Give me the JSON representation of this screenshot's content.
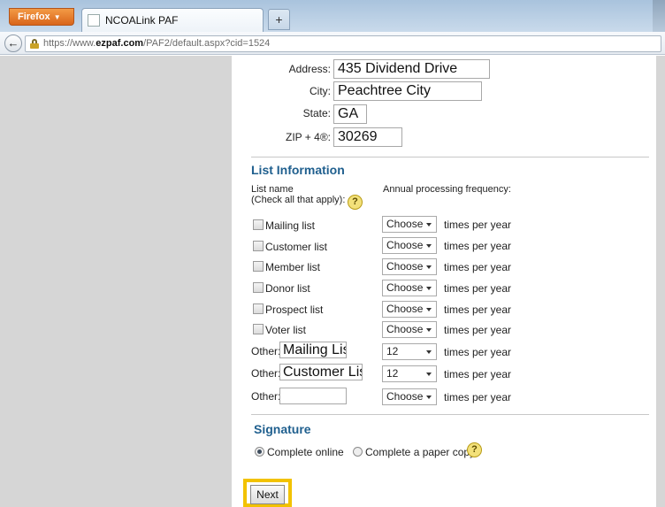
{
  "browser": {
    "firefox_label": "Firefox",
    "tab_title": "NCOALink PAF",
    "new_tab_label": "+",
    "url": {
      "prefix": "https://www.",
      "domain": "ezpaf.com",
      "path": "/PAF2/default.aspx?cid=1524"
    }
  },
  "address": {
    "address_label": "Address:",
    "address_value": "435 Dividend Drive",
    "city_label": "City:",
    "city_value": "Peachtree City",
    "state_label": "State:",
    "state_value": "GA",
    "zip_label": "ZIP + 4®:",
    "zip_value": "30269"
  },
  "list_info": {
    "title": "List Information",
    "list_name_header_1": "List name",
    "list_name_header_2": "(Check all that apply):",
    "frequency_header": "Annual processing frequency:",
    "times_per_year": "times per year",
    "lists": [
      {
        "label": "Mailing list",
        "frequency": "Choose",
        "checked": false
      },
      {
        "label": "Customer list",
        "frequency": "Choose",
        "checked": false
      },
      {
        "label": "Member list",
        "frequency": "Choose",
        "checked": false
      },
      {
        "label": "Donor list",
        "frequency": "Choose",
        "checked": false
      },
      {
        "label": "Prospect list",
        "frequency": "Choose",
        "checked": false
      },
      {
        "label": "Voter list",
        "frequency": "Choose",
        "checked": false
      }
    ],
    "other_label": "Other:",
    "others": [
      {
        "value": "Mailing List",
        "frequency": "12"
      },
      {
        "value": "Customer List",
        "frequency": "12"
      },
      {
        "value": "",
        "frequency": "Choose"
      }
    ]
  },
  "signature": {
    "title": "Signature",
    "option_online": "Complete online",
    "option_paper": "Complete a paper copy",
    "selected": "online"
  },
  "help_icon_glyph": "?",
  "next_label": "Next",
  "colors": {
    "section_title": "#1f5f8e",
    "highlight": "#f2c200",
    "firefox_button": "#e27a27"
  }
}
